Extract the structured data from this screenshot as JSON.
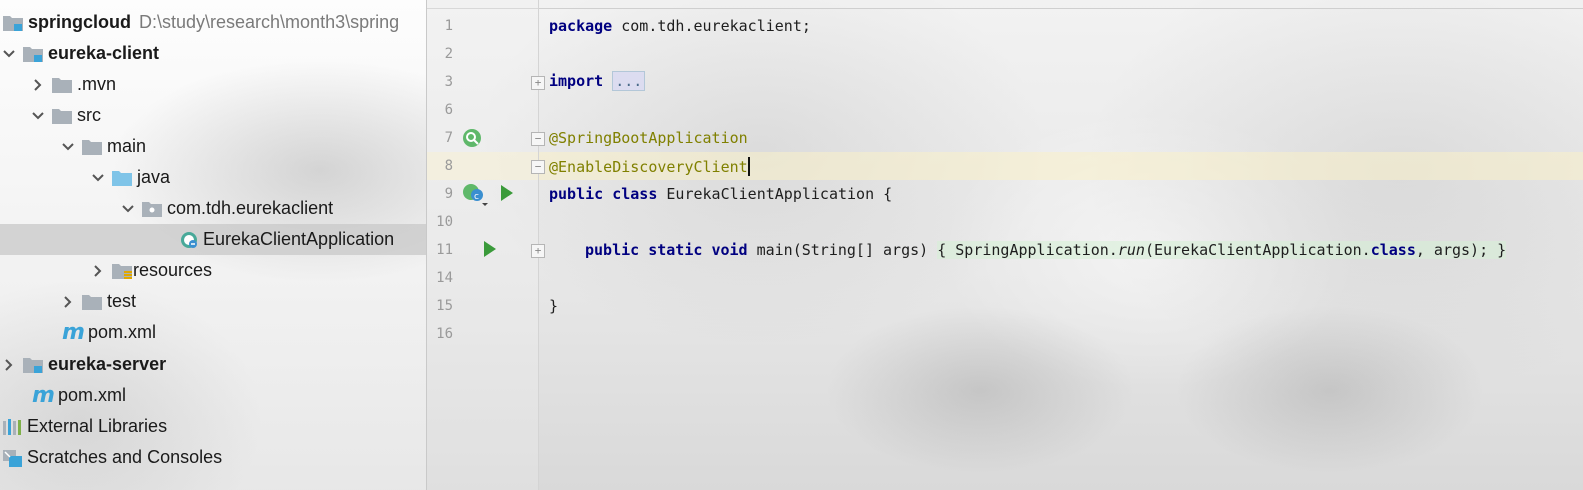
{
  "project": {
    "root_name": "springcloud",
    "root_path": "D:\\study\\research\\month3\\spring",
    "items": [
      {
        "label": "eureka-client",
        "bold": true
      },
      {
        "label": ".mvn"
      },
      {
        "label": "src"
      },
      {
        "label": "main"
      },
      {
        "label": "java"
      },
      {
        "label": "com.tdh.eurekaclient"
      },
      {
        "label": "EurekaClientApplication"
      },
      {
        "label": "resources"
      },
      {
        "label": "test"
      },
      {
        "label": "pom.xml"
      },
      {
        "label": "eureka-server",
        "bold": true
      },
      {
        "label": "pom.xml"
      },
      {
        "label": "External Libraries"
      },
      {
        "label": "Scratches and Consoles"
      }
    ],
    "maven_glyph": "m"
  },
  "editor": {
    "line_numbers": [
      "1",
      "2",
      "3",
      "6",
      "7",
      "8",
      "9",
      "10",
      "11",
      "14",
      "15",
      "16"
    ],
    "lines": {
      "l1_kw": "package",
      "l1_rest": " com.tdh.eurekaclient;",
      "l3_kw": "import",
      "l3_fold": "...",
      "l7": "@SpringBootApplication",
      "l8": "@EnableDiscoveryClient",
      "l9_kw1": "public",
      "l9_kw2": "class",
      "l9_rest": " EurekaClientApplication {",
      "l11_kw1": "public",
      "l11_kw2": "static",
      "l11_kw3": "void",
      "l11_sig": " main(String[] args) ",
      "l11_body1": "{ SpringApplication.",
      "l11_run": "run",
      "l11_body2": "(EurekaClientApplication.",
      "l11_class": "class",
      "l11_body3": ", args); }",
      "l15": "}"
    },
    "class_badge": "c"
  },
  "colors": {
    "keyword": "#000080",
    "annotation": "#808000",
    "run_icon": "#3a9a3a",
    "folder": "#a9b1b9",
    "source_folder": "#7fc4e8"
  }
}
